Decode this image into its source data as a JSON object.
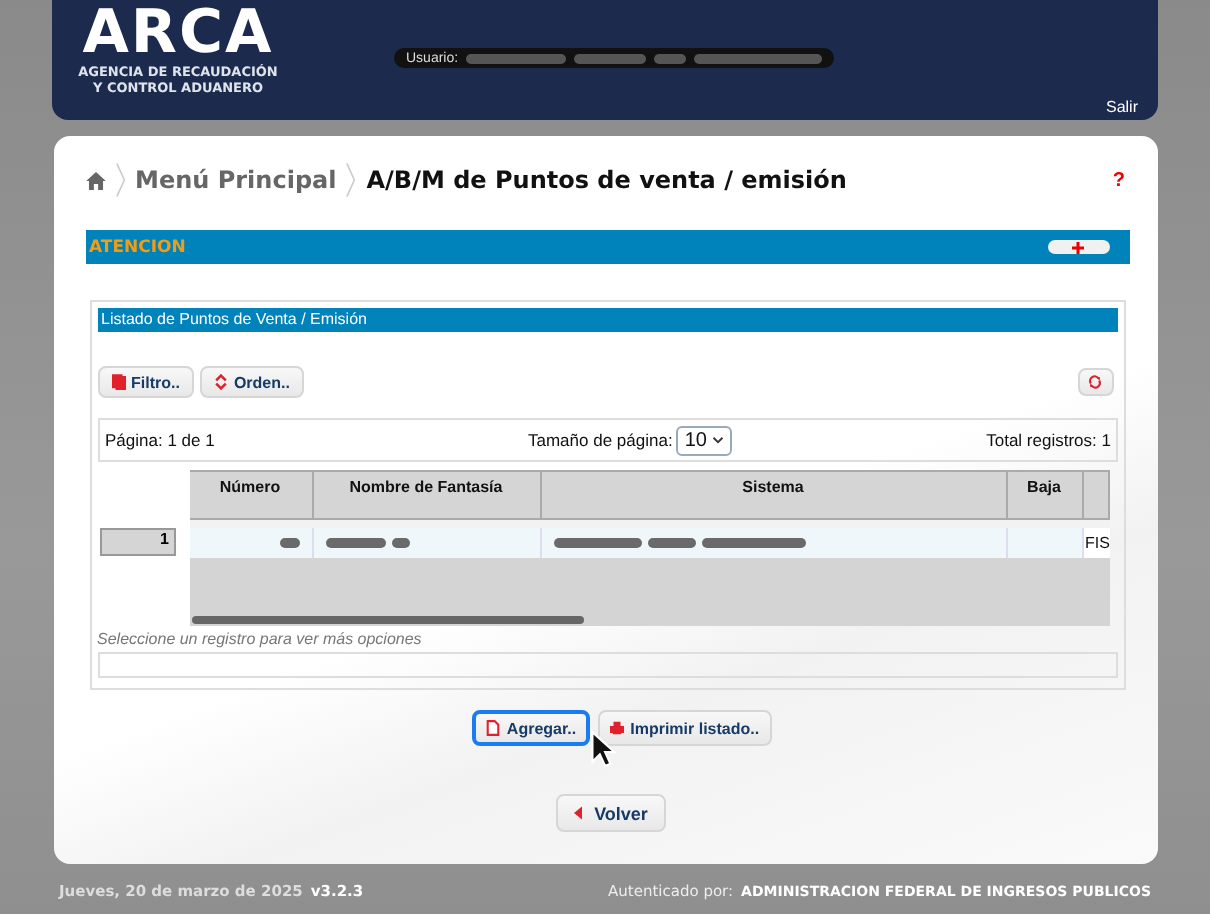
{
  "header": {
    "logo": "ARCA",
    "logo_subtitle": [
      "AGENCIA DE RECAUDACIÓN",
      "Y CONTROL ADUANERO"
    ],
    "user_label": "Usuario:",
    "logout": "Salir"
  },
  "breadcrumb": [
    "Menú Principal",
    "A/B/M de Puntos de venta / emisión"
  ],
  "help": "?",
  "notice": {
    "title": "ATENCION"
  },
  "list": {
    "title": "Listado de Puntos de Venta / Emisión",
    "toolbar": [
      {
        "label": "Filtro..",
        "kind": "filter"
      },
      {
        "label": "Orden..",
        "kind": "sort"
      }
    ],
    "pager": {
      "page": "Página: 1 de 1",
      "size_label": "Tamaño de página:",
      "size": "10",
      "total": "Total registros: 1"
    },
    "columns": [
      "Número",
      "Nombre de Fantasía",
      "Sistema",
      "Baja"
    ],
    "rows": [
      {
        "index": "1",
        "column_5": "FIS"
      }
    ],
    "hint": "Seleccione un registro para ver más opciones",
    "actions": [
      {
        "label": "Agregar..",
        "kind": "add",
        "focused": true
      },
      {
        "label": "Imprimir listado..",
        "kind": "print",
        "focused": false
      }
    ]
  },
  "back": "Volver",
  "footer": {
    "date": "Jueves, 20 de marzo de 2025",
    "version": "v3.2.3",
    "auth_label": "Autenticado por:",
    "auth": "ADMINISTRACION FEDERAL DE INGRESOS PUBLICOS"
  }
}
